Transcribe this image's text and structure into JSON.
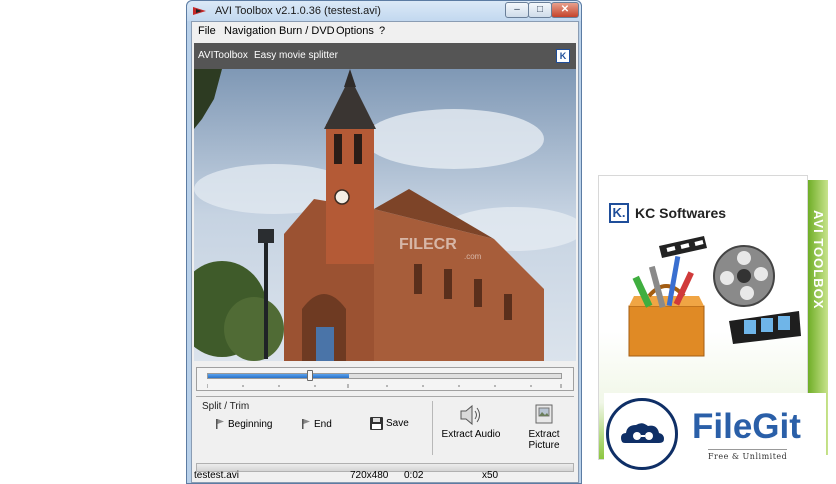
{
  "window": {
    "title": "AVI Toolbox v2.1.0.36 (testest.avi)",
    "controls": {
      "minimize": "–",
      "maximize": "□",
      "close": "✕"
    }
  },
  "menu": [
    {
      "label": "File"
    },
    {
      "label": "Navigation"
    },
    {
      "label": "Burn / DVD"
    },
    {
      "label": "Options"
    },
    {
      "label": "?"
    }
  ],
  "banner": {
    "app_name": "AVIToolbox",
    "tagline": "Easy movie splitter"
  },
  "video": {
    "watermark": "FILECR",
    "watermark_sub": ".com"
  },
  "seek": {
    "fill_fraction": 0.4,
    "thumb_fraction": 0.29
  },
  "split": {
    "group_label": "Split / Trim",
    "beginning": "Beginning",
    "end": "End",
    "save": "Save"
  },
  "extract": {
    "audio": "Extract Audio",
    "picture": "Extract Picture"
  },
  "status": {
    "file": "testest.avi",
    "resolution": "720x480",
    "time": "0:02",
    "speed": "x50"
  },
  "product": {
    "brand": "KC Softwares",
    "logo_text": "K.",
    "side_text": "AVI TOOLBOX"
  },
  "filegit": {
    "name": "FileGit",
    "tagline": "Free & Unlimited"
  },
  "colors": {
    "seek_fill": "#2a72c8",
    "banner_bg": "#555555",
    "filegit_blue": "#2a5fa8",
    "box_green": "#8cc63f"
  }
}
